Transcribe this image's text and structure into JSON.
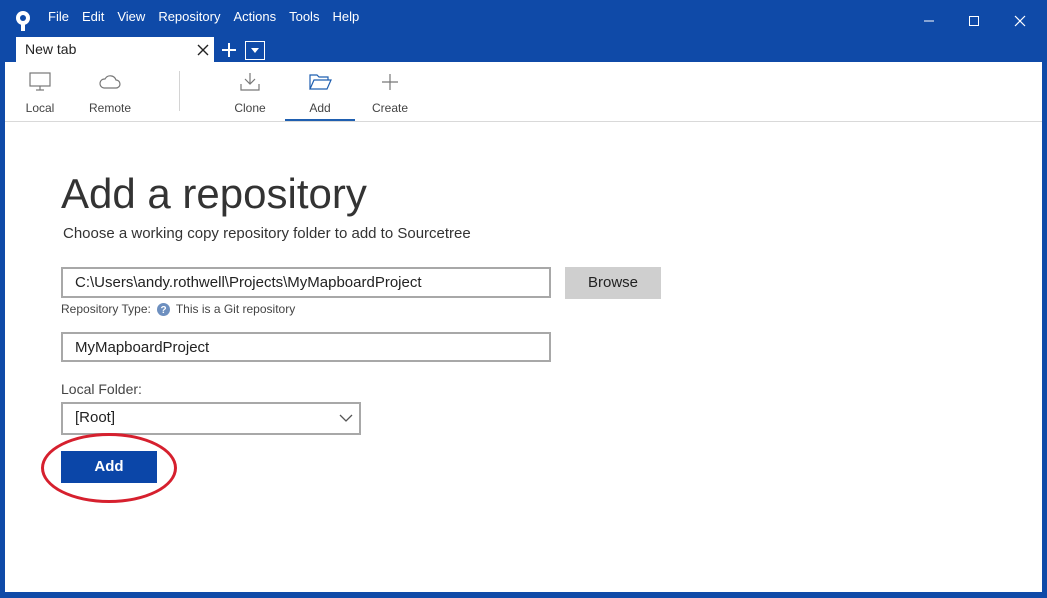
{
  "menu": [
    "File",
    "Edit",
    "View",
    "Repository",
    "Actions",
    "Tools",
    "Help"
  ],
  "tabs": {
    "active_label": "New tab"
  },
  "toolbar": {
    "local": "Local",
    "remote": "Remote",
    "clone": "Clone",
    "add": "Add",
    "create": "Create",
    "active": "Add"
  },
  "main": {
    "title": "Add a repository",
    "subtitle": "Choose a working copy repository folder to add to Sourcetree",
    "path_value": "C:\\Users\\andy.rothwell\\Projects\\MyMapboardProject",
    "browse_label": "Browse",
    "repo_type_label": "Repository Type:",
    "repo_type_value": "This is a Git repository",
    "name_value": "MyMapboardProject",
    "local_folder_label": "Local Folder:",
    "local_folder_value": "[Root]",
    "add_button": "Add"
  },
  "colors": {
    "chrome": "#0f4aa8",
    "primary_button": "#0b46a8",
    "highlight": "#d6202e"
  }
}
